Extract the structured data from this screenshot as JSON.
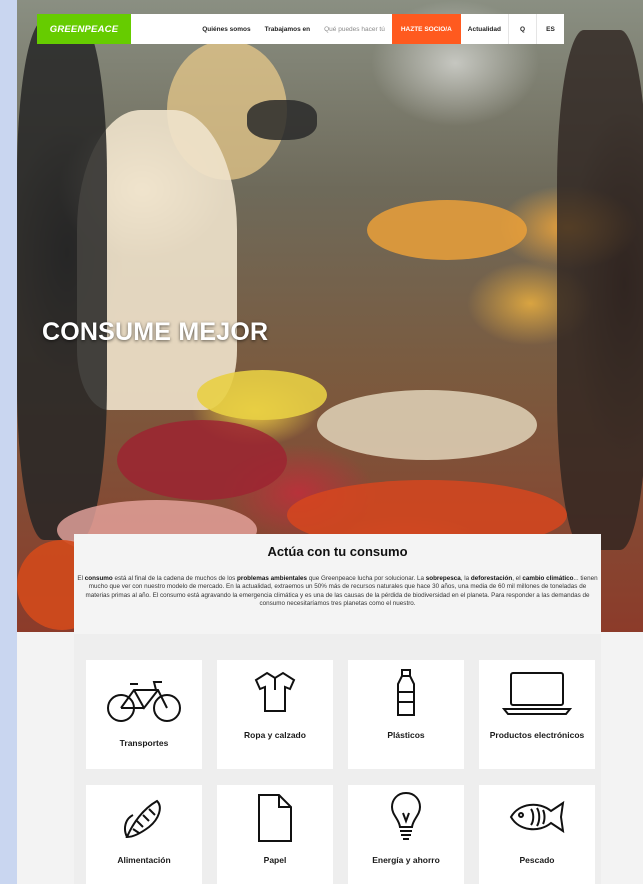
{
  "nav": {
    "logo": "GREENPEACE",
    "items": [
      "Quiénes somos",
      "Trabajamos en",
      "Qué puedes hacer tú"
    ],
    "cta": "HAZTE SOCIO/A",
    "news": "Actualidad",
    "search_icon": "Q",
    "lang": "ES"
  },
  "hero": {
    "title": "CONSUME MEJOR"
  },
  "intro": {
    "heading": "Actúa con tu consumo",
    "p1": "El ",
    "b1": "consumo",
    "p2": " está al final de la cadena de muchos de los ",
    "b2": "problemas ambientales",
    "p3": " que Greenpeace lucha por solucionar. La ",
    "b3": "sobrepesca",
    "p4": ", la ",
    "b4": "deforestación",
    "p5": ", el ",
    "b5": "cambio climático",
    "p6": "... tienen mucho que ver con nuestro modelo de mercado. En la actualidad, extraemos un 50% más de recursos naturales que hace 30 años, una media de 60 mil millones de toneladas de materias primas al año. El consumo está agravando la emergencia climática y es una de las causas de la pérdida de biodiversidad en el planeta. Para responder a las demandas de consumo necesitaríamos tres planetas como el nuestro."
  },
  "categories": [
    {
      "label": "Transportes",
      "icon": "bicycle-icon"
    },
    {
      "label": "Ropa y calzado",
      "icon": "shirt-icon"
    },
    {
      "label": "Plásticos",
      "icon": "bottle-icon"
    },
    {
      "label": "Productos electrónicos",
      "icon": "laptop-icon"
    },
    {
      "label": "Alimentación",
      "icon": "corn-icon"
    },
    {
      "label": "Papel",
      "icon": "paper-icon"
    },
    {
      "label": "Energía y ahorro",
      "icon": "lightbulb-icon"
    },
    {
      "label": "Pescado",
      "icon": "fish-icon"
    }
  ],
  "colors": {
    "brand_green": "#66cc00",
    "cta_orange": "#ff5a1f"
  }
}
